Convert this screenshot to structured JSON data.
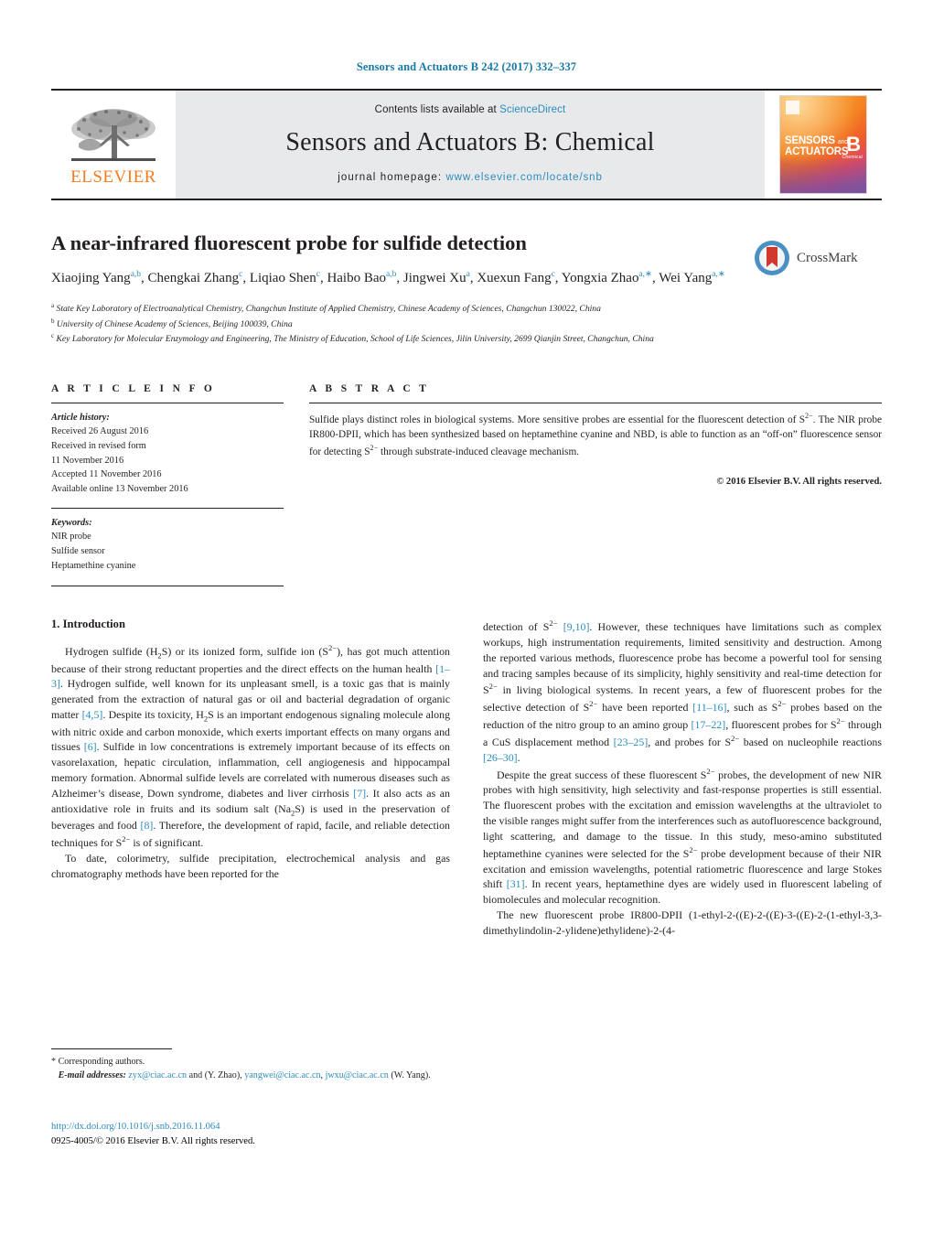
{
  "running_head": "Sensors and Actuators B 242 (2017) 332–337",
  "masthead": {
    "publisher_logo_name": "elsevier-tree-logo",
    "publisher_wordmark": "ELSEVIER",
    "contents_prefix": "Contents lists available at ",
    "contents_link": "ScienceDirect",
    "journal_title": "Sensors and Actuators B: Chemical",
    "homepage_prefix": "journal homepage: ",
    "homepage_url": "www.elsevier.com/locate/snb",
    "cover": {
      "line1": "SENSORS",
      "and": "and",
      "line2": "ACTUATORS",
      "letter": "B",
      "sub": "Chemical"
    }
  },
  "article": {
    "title": "A near-infrared fluorescent probe for sulfide detection",
    "authors_html": "Xiaojing Yang<sup>a,b</sup>, Chengkai Zhang<sup>c</sup>, Liqiao Shen<sup>c</sup>, Haibo Bao<sup>a,b</sup>, Jingwei Xu<sup>a</sup>, Xuexun Fang<sup>c</sup>, Yongxia Zhao<sup>a,∗</sup>, Wei Yang<sup>a,∗</sup>",
    "crossmark_label": "CrossMark",
    "affiliations": [
      {
        "mark": "a",
        "text": "State Key Laboratory of Electroanalytical Chemistry, Changchun Institute of Applied Chemistry, Chinese Academy of Sciences, Changchun 130022, China"
      },
      {
        "mark": "b",
        "text": "University of Chinese Academy of Sciences, Beijing 100039, China"
      },
      {
        "mark": "c",
        "text": "Key Laboratory for Molecular Enzymology and Engineering, The Ministry of Education, School of Life Sciences, Jilin University, 2699 Qianjin Street, Changchun, China"
      }
    ]
  },
  "article_info": {
    "heading": "A R T I C L E   I N F O",
    "history_label": "Article history:",
    "history": [
      "Received 26 August 2016",
      "Received in revised form",
      "11 November 2016",
      "Accepted 11 November 2016",
      "Available online 13 November 2016"
    ],
    "keywords_label": "Keywords:",
    "keywords": [
      "NIR probe",
      "Sulfide sensor",
      "Heptamethine cyanine"
    ]
  },
  "abstract": {
    "heading": "A B S T R A C T",
    "body_html": "Sulfide plays distinct roles in biological systems. More sensitive probes are essential for the fluorescent detection of S<sup>2−</sup>. The NIR probe IR800-DPII, which has been synthesized based on heptamethine cyanine and NBD, is able to function as an “off-on” fluorescence sensor for detecting S<sup>2−</sup> through substrate-induced cleavage mechanism.",
    "rights": "© 2016 Elsevier B.V. All rights reserved."
  },
  "body": {
    "section_heading": "1.  Introduction",
    "left_paragraphs_html": [
      "Hydrogen sulfide (H<sub>2</sub>S) or its ionized form, sulfide ion (S<sup>2−</sup>), has got much attention because of their strong reductant properties and the direct effects on the human health <span class=\"cite\">[1–3]</span>. Hydrogen sulfide, well known for its unpleasant smell, is a toxic gas that is mainly generated from the extraction of natural gas or oil and bacterial degradation of organic matter <span class=\"cite\">[4,5]</span>. Despite its toxicity, H<sub>2</sub>S is an important endogenous signaling molecule along with nitric oxide and carbon monoxide, which exerts important effects on many organs and tissues <span class=\"cite\">[6]</span>. Sulfide in low concentrations is extremely important because of its effects on vasorelaxation, hepatic circulation, inflammation, cell angiogenesis and hippocampal memory formation. Abnormal sulfide levels are correlated with numerous diseases such as Alzheimer’s disease, Down syndrome, diabetes and liver cirrhosis <span class=\"cite\">[7]</span>. It also acts as an antioxidative role in fruits and its sodium salt (Na<sub>2</sub>S) is used in the preservation of beverages and food <span class=\"cite\">[8]</span>. Therefore, the development of rapid, facile, and reliable detection techniques for S<sup>2−</sup> is of significant.",
      "To date, colorimetry, sulfide precipitation, electrochemical analysis and gas chromatography methods have been reported for the"
    ],
    "right_paragraphs_html": [
      "detection of S<sup>2−</sup> <span class=\"cite\">[9,10]</span>. However, these techniques have limitations such as complex workups, high instrumentation requirements, limited sensitivity and destruction. Among the reported various methods, fluorescence probe has become a powerful tool for sensing and tracing samples because of its simplicity, highly sensitivity and real-time detection for S<sup>2−</sup> in living biological systems. In recent years, a few of fluorescent probes for the selective detection of S<sup>2−</sup> have been reported <span class=\"cite\">[11–16]</span>, such as S<sup>2−</sup> probes based on the reduction of the nitro group to an amino group <span class=\"cite\">[17–22]</span>, fluorescent probes for S<sup>2−</sup> through a CuS displacement method <span class=\"cite\">[23–25]</span>, and probes for S<sup>2−</sup> based on nucleophile reactions <span class=\"cite\">[26–30]</span>.",
      "Despite the great success of these fluorescent S<sup>2−</sup> probes, the development of new NIR probes with high sensitivity, high selectivity and fast-response properties is still essential. The fluorescent probes with the excitation and emission wavelengths at the ultraviolet to the visible ranges might suffer from the interferences such as autofluorescence background, light scattering, and damage to the tissue. In this study, meso-amino substituted heptamethine cyanines were selected for the S<sup>2−</sup> probe development because of their NIR excitation and emission wavelengths, potential ratiometric fluorescence and large Stokes shift <span class=\"cite\">[31]</span>. In recent years, heptamethine dyes are widely used in fluorescent labeling of biomolecules and molecular recognition.",
      "The new fluorescent probe IR800-DPII (1-ethyl-2-((E)-2-((E)-3-((E)-2-(1-ethyl-3,3-  dimethylindolin-2-ylidene)ethylidene)-2-(4-"
    ]
  },
  "footnotes": {
    "corresponding": "*  Corresponding authors.",
    "email_label": "E-mail addresses:",
    "email1": "zyx@ciac.ac.cn",
    "email1_after": " and (Y. Zhao), ",
    "email2": "yangwei@ciac.ac.cn",
    "email2_sep": ", ",
    "email3": "jwxu@ciac.ac.cn",
    "email3_after": " (W. Yang)."
  },
  "doi_block": {
    "doi_url": "http://dx.doi.org/10.1016/j.snb.2016.11.064",
    "issn_line": "0925-4005/© 2016 Elsevier B.V. All rights reserved."
  },
  "colors": {
    "link_blue": "#2b8cbe",
    "head_blue": "#1679a8",
    "elsevier_orange": "#f47d20",
    "mast_grey": "#e8e9ea",
    "ink": "#231f20"
  }
}
